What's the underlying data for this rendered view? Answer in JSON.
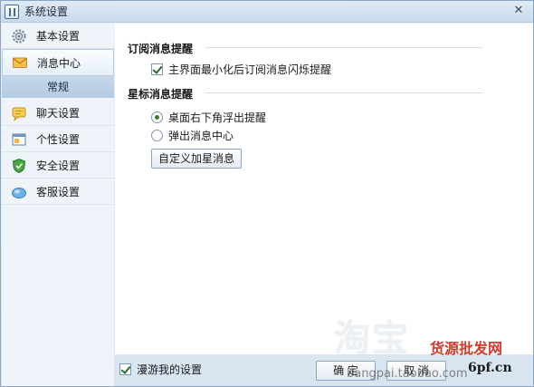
{
  "window": {
    "title": "系统设置",
    "close_glyph": "✕"
  },
  "sidebar": {
    "items": [
      {
        "label": "基本设置",
        "icon": "gear-icon"
      },
      {
        "label": "消息中心",
        "icon": "envelope-icon"
      },
      {
        "label": "聊天设置",
        "icon": "chat-bubble-icon"
      },
      {
        "label": "个性设置",
        "icon": "window-icon"
      },
      {
        "label": "安全设置",
        "icon": "shield-icon"
      },
      {
        "label": "客服设置",
        "icon": "service-cloud-icon"
      }
    ],
    "sub_item": "常规",
    "colors": {
      "shield": "#3e9b3a",
      "envelope": "#e8a93a",
      "chat": "#f0b83c",
      "service": "#5a9fd8"
    }
  },
  "main": {
    "subscription": {
      "title": "订阅消息提醒",
      "option_label": "主界面最小化后订阅消息闪烁提醒",
      "checked": true
    },
    "star": {
      "title": "星标消息提醒",
      "options": [
        {
          "label": "桌面右下角浮出提醒",
          "selected": true
        },
        {
          "label": "弹出消息中心",
          "selected": false
        }
      ],
      "custom_button": "自定义加星消息"
    }
  },
  "footer": {
    "roaming_label": "漫游我的设置",
    "roaming_checked": true,
    "ok_button": "确 定",
    "cancel_button": "取 消"
  },
  "watermarks": {
    "big": "淘宝",
    "red": "货源批发网",
    "url": "6pf.cn",
    "site": "bangpai.taobao.com"
  }
}
